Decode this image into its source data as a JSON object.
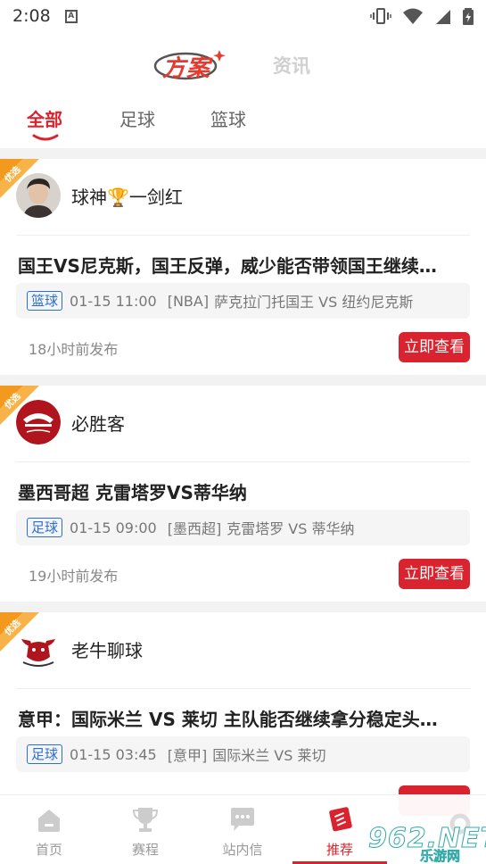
{
  "status": {
    "time": "2:08",
    "a_icon_letter": "A"
  },
  "header": {
    "logo_text": "方案",
    "news_tab": "资讯",
    "sub_tabs": [
      "全部",
      "足球",
      "篮球"
    ]
  },
  "cards": [
    {
      "badge": "优选",
      "author": "球神🏆一剑红",
      "title": "国王VS尼克斯，国王反弹，威少能否带领国王继续…",
      "sport": "篮球",
      "time": "01-15 11:00",
      "league": "[NBA]",
      "match": "萨克拉门托国王 VS 纽约尼克斯",
      "posted": "18小时前发布",
      "button": "立即查看"
    },
    {
      "badge": "优选",
      "author": "必胜客",
      "title": "墨西哥超 克雷塔罗VS蒂华纳",
      "sport": "足球",
      "time": "01-15 09:00",
      "league": "[墨西超]",
      "match": "克雷塔罗 VS 蒂华纳",
      "posted": "19小时前发布",
      "button": "立即查看"
    },
    {
      "badge": "优选",
      "author": "老牛聊球",
      "title": "意甲：国际米兰 VS 莱切  主队能否继续拿分稳定头…",
      "sport": "足球",
      "time": "01-15 03:45",
      "league": "[意甲]",
      "match": "国际米兰 VS 莱切",
      "posted": "",
      "button": ""
    }
  ],
  "bottom_nav": [
    "首页",
    "赛程",
    "站内信",
    "推荐"
  ],
  "watermark": {
    "main": "962.NET",
    "sub": "乐游网"
  },
  "colors": {
    "accent": "#d9232e",
    "tag_blue": "#2a6fd1",
    "badge_orange": "#f39a1e"
  }
}
